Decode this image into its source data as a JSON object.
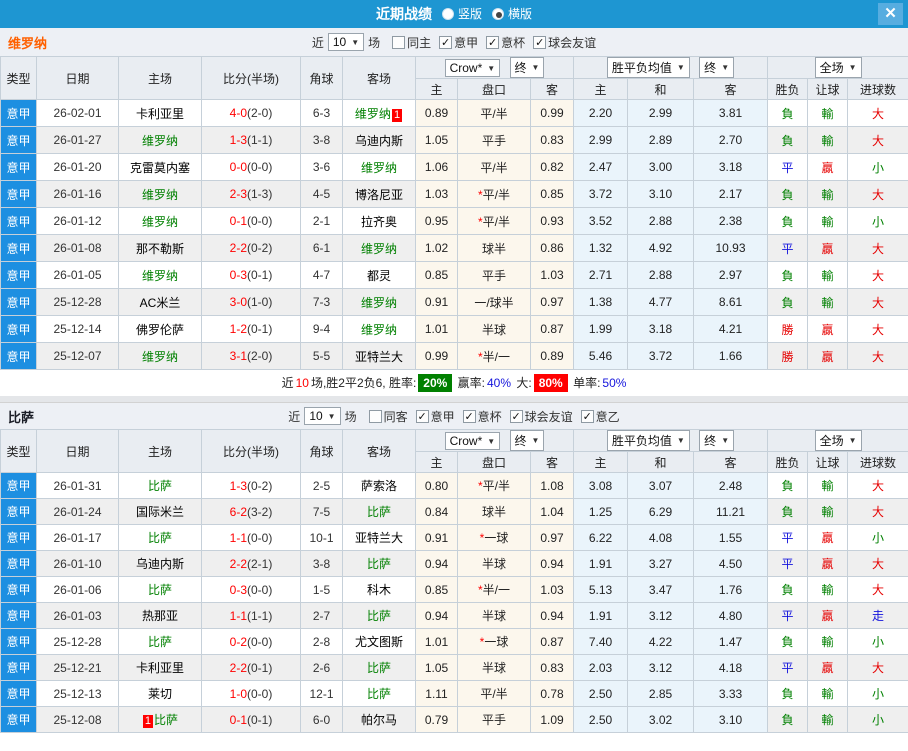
{
  "titlebar": {
    "title": "近期战绩",
    "radios": [
      {
        "label": "竖版",
        "selected": false
      },
      {
        "label": "横版",
        "selected": true
      }
    ],
    "close": "✕"
  },
  "filter_common": {
    "near": "近",
    "games_count": "10",
    "games": "场"
  },
  "header_controls": {
    "odds_select": "Crow*",
    "odds_final": "终",
    "avg_select": "胜平负均值",
    "avg_final": "终",
    "scope_select": "全场"
  },
  "columns": {
    "type": "类型",
    "date": "日期",
    "home": "主场",
    "score": "比分(半场)",
    "corner": "角球",
    "away": "客场",
    "odds_home": "主",
    "handicap": "盘口",
    "odds_away": "客",
    "avg_home": "主",
    "avg_draw": "和",
    "avg_away": "客",
    "wdl": "胜负",
    "handicap_res": "让球",
    "goals": "进球数"
  },
  "teams": [
    {
      "name": "维罗纳",
      "filters": [
        {
          "label": "同主",
          "checked": false
        },
        {
          "label": "意甲",
          "checked": true
        },
        {
          "label": "意杯",
          "checked": true
        },
        {
          "label": "球会友谊",
          "checked": true
        }
      ],
      "rows": [
        {
          "league": "意甲",
          "date": "26-02-01",
          "home": {
            "name": "卡利亚里"
          },
          "score": {
            "main": "4-0",
            "half": "(2-0)"
          },
          "corner": "6-3",
          "away": {
            "name": "维罗纳",
            "green": true,
            "badge": "1",
            "badge_pos": "after"
          },
          "o1": "0.89",
          "hcp": {
            "text": "平/半"
          },
          "o2": "0.99",
          "a1": "2.20",
          "a2": "2.99",
          "a3": "3.81",
          "wdl": {
            "t": "負",
            "c": "g"
          },
          "hres": {
            "t": "輸",
            "c": "g"
          },
          "gres": {
            "t": "大",
            "c": "r"
          }
        },
        {
          "league": "意甲",
          "date": "26-01-27",
          "home": {
            "name": "维罗纳",
            "green": true
          },
          "score": {
            "main": "1-3",
            "half": "(1-1)"
          },
          "corner": "3-8",
          "away": {
            "name": "乌迪内斯"
          },
          "o1": "1.05",
          "hcp": {
            "text": "平手"
          },
          "o2": "0.83",
          "a1": "2.99",
          "a2": "2.89",
          "a3": "2.70",
          "wdl": {
            "t": "負",
            "c": "g"
          },
          "hres": {
            "t": "輸",
            "c": "g"
          },
          "gres": {
            "t": "大",
            "c": "r"
          }
        },
        {
          "league": "意甲",
          "date": "26-01-20",
          "home": {
            "name": "克雷莫内塞"
          },
          "score": {
            "main": "0-0",
            "half": "(0-0)"
          },
          "corner": "3-6",
          "away": {
            "name": "维罗纳",
            "green": true
          },
          "o1": "1.06",
          "hcp": {
            "text": "平/半"
          },
          "o2": "0.82",
          "a1": "2.47",
          "a2": "3.00",
          "a3": "3.18",
          "wdl": {
            "t": "平",
            "c": "b"
          },
          "hres": {
            "t": "贏",
            "c": "r"
          },
          "gres": {
            "t": "小",
            "c": "g"
          }
        },
        {
          "league": "意甲",
          "date": "26-01-16",
          "home": {
            "name": "维罗纳",
            "green": true
          },
          "score": {
            "main": "2-3",
            "half": "(1-3)"
          },
          "corner": "4-5",
          "away": {
            "name": "博洛尼亚"
          },
          "o1": "1.03",
          "hcp": {
            "star": true,
            "text": "平/半"
          },
          "o2": "0.85",
          "a1": "3.72",
          "a2": "3.10",
          "a3": "2.17",
          "wdl": {
            "t": "負",
            "c": "g"
          },
          "hres": {
            "t": "輸",
            "c": "g"
          },
          "gres": {
            "t": "大",
            "c": "r"
          }
        },
        {
          "league": "意甲",
          "date": "26-01-12",
          "home": {
            "name": "维罗纳",
            "green": true
          },
          "score": {
            "main": "0-1",
            "half": "(0-0)"
          },
          "corner": "2-1",
          "away": {
            "name": "拉齐奥"
          },
          "o1": "0.95",
          "hcp": {
            "star": true,
            "text": "平/半"
          },
          "o2": "0.93",
          "a1": "3.52",
          "a2": "2.88",
          "a3": "2.38",
          "wdl": {
            "t": "負",
            "c": "g"
          },
          "hres": {
            "t": "輸",
            "c": "g"
          },
          "gres": {
            "t": "小",
            "c": "g"
          }
        },
        {
          "league": "意甲",
          "date": "26-01-08",
          "home": {
            "name": "那不勒斯"
          },
          "score": {
            "main": "2-2",
            "half": "(0-2)"
          },
          "corner": "6-1",
          "away": {
            "name": "维罗纳",
            "green": true
          },
          "o1": "1.02",
          "hcp": {
            "text": "球半"
          },
          "o2": "0.86",
          "a1": "1.32",
          "a2": "4.92",
          "a3": "10.93",
          "wdl": {
            "t": "平",
            "c": "b"
          },
          "hres": {
            "t": "贏",
            "c": "r"
          },
          "gres": {
            "t": "大",
            "c": "r"
          }
        },
        {
          "league": "意甲",
          "date": "26-01-05",
          "home": {
            "name": "维罗纳",
            "green": true
          },
          "score": {
            "main": "0-3",
            "half": "(0-1)"
          },
          "corner": "4-7",
          "away": {
            "name": "都灵"
          },
          "o1": "0.85",
          "hcp": {
            "text": "平手"
          },
          "o2": "1.03",
          "a1": "2.71",
          "a2": "2.88",
          "a3": "2.97",
          "wdl": {
            "t": "負",
            "c": "g"
          },
          "hres": {
            "t": "輸",
            "c": "g"
          },
          "gres": {
            "t": "大",
            "c": "r"
          }
        },
        {
          "league": "意甲",
          "date": "25-12-28",
          "home": {
            "name": "AC米兰"
          },
          "score": {
            "main": "3-0",
            "half": "(1-0)"
          },
          "corner": "7-3",
          "away": {
            "name": "维罗纳",
            "green": true
          },
          "o1": "0.91",
          "hcp": {
            "text": "一/球半"
          },
          "o2": "0.97",
          "a1": "1.38",
          "a2": "4.77",
          "a3": "8.61",
          "wdl": {
            "t": "負",
            "c": "g"
          },
          "hres": {
            "t": "輸",
            "c": "g"
          },
          "gres": {
            "t": "大",
            "c": "r"
          }
        },
        {
          "league": "意甲",
          "date": "25-12-14",
          "home": {
            "name": "佛罗伦萨"
          },
          "score": {
            "main": "1-2",
            "half": "(0-1)"
          },
          "corner": "9-4",
          "away": {
            "name": "维罗纳",
            "green": true
          },
          "o1": "1.01",
          "hcp": {
            "text": "半球"
          },
          "o2": "0.87",
          "a1": "1.99",
          "a2": "3.18",
          "a3": "4.21",
          "wdl": {
            "t": "勝",
            "c": "r"
          },
          "hres": {
            "t": "贏",
            "c": "r"
          },
          "gres": {
            "t": "大",
            "c": "r"
          }
        },
        {
          "league": "意甲",
          "date": "25-12-07",
          "home": {
            "name": "维罗纳",
            "green": true
          },
          "score": {
            "main": "3-1",
            "half": "(2-0)"
          },
          "corner": "5-5",
          "away": {
            "name": "亚特兰大"
          },
          "o1": "0.99",
          "hcp": {
            "star": true,
            "text": "半/一"
          },
          "o2": "0.89",
          "a1": "5.46",
          "a2": "3.72",
          "a3": "1.66",
          "wdl": {
            "t": "勝",
            "c": "r"
          },
          "hres": {
            "t": "贏",
            "c": "r"
          },
          "gres": {
            "t": "大",
            "c": "r"
          }
        }
      ],
      "summary": [
        {
          "text": "近",
          "style": "plain"
        },
        {
          "text": "10",
          "style": "red"
        },
        {
          "text": "场,胜2平2负6, 胜率:",
          "style": "plain"
        },
        {
          "text": "20%",
          "style": "badge-green"
        },
        {
          "text": " 赢率:",
          "style": "plain"
        },
        {
          "text": "40%",
          "style": "blue"
        },
        {
          "text": " 大:",
          "style": "plain"
        },
        {
          "text": "80%",
          "style": "badge-red"
        },
        {
          "text": " 单率:",
          "style": "plain"
        },
        {
          "text": "50%",
          "style": "blue"
        }
      ]
    },
    {
      "name": "比萨",
      "filters": [
        {
          "label": "同客",
          "checked": false
        },
        {
          "label": "意甲",
          "checked": true
        },
        {
          "label": "意杯",
          "checked": true
        },
        {
          "label": "球会友谊",
          "checked": true
        },
        {
          "label": "意乙",
          "checked": true
        }
      ],
      "rows": [
        {
          "league": "意甲",
          "date": "26-01-31",
          "home": {
            "name": "比萨",
            "green": true
          },
          "score": {
            "main": "1-3",
            "half": "(0-2)"
          },
          "corner": "2-5",
          "away": {
            "name": "萨索洛"
          },
          "o1": "0.80",
          "hcp": {
            "star": true,
            "text": "平/半"
          },
          "o2": "1.08",
          "a1": "3.08",
          "a2": "3.07",
          "a3": "2.48",
          "wdl": {
            "t": "負",
            "c": "g"
          },
          "hres": {
            "t": "輸",
            "c": "g"
          },
          "gres": {
            "t": "大",
            "c": "r"
          }
        },
        {
          "league": "意甲",
          "date": "26-01-24",
          "home": {
            "name": "国际米兰"
          },
          "score": {
            "main": "6-2",
            "half": "(3-2)"
          },
          "corner": "7-5",
          "away": {
            "name": "比萨",
            "green": true
          },
          "o1": "0.84",
          "hcp": {
            "text": "球半"
          },
          "o2": "1.04",
          "a1": "1.25",
          "a2": "6.29",
          "a3": "11.21",
          "wdl": {
            "t": "負",
            "c": "g"
          },
          "hres": {
            "t": "輸",
            "c": "g"
          },
          "gres": {
            "t": "大",
            "c": "r"
          }
        },
        {
          "league": "意甲",
          "date": "26-01-17",
          "home": {
            "name": "比萨",
            "green": true
          },
          "score": {
            "main": "1-1",
            "half": "(0-0)"
          },
          "corner": "10-1",
          "away": {
            "name": "亚特兰大"
          },
          "o1": "0.91",
          "hcp": {
            "star": true,
            "text": "一球"
          },
          "o2": "0.97",
          "a1": "6.22",
          "a2": "4.08",
          "a3": "1.55",
          "wdl": {
            "t": "平",
            "c": "b"
          },
          "hres": {
            "t": "贏",
            "c": "r"
          },
          "gres": {
            "t": "小",
            "c": "g"
          }
        },
        {
          "league": "意甲",
          "date": "26-01-10",
          "home": {
            "name": "乌迪内斯"
          },
          "score": {
            "main": "2-2",
            "half": "(2-1)"
          },
          "corner": "3-8",
          "away": {
            "name": "比萨",
            "green": true
          },
          "o1": "0.94",
          "hcp": {
            "text": "半球"
          },
          "o2": "0.94",
          "a1": "1.91",
          "a2": "3.27",
          "a3": "4.50",
          "wdl": {
            "t": "平",
            "c": "b"
          },
          "hres": {
            "t": "贏",
            "c": "r"
          },
          "gres": {
            "t": "大",
            "c": "r"
          }
        },
        {
          "league": "意甲",
          "date": "26-01-06",
          "home": {
            "name": "比萨",
            "green": true
          },
          "score": {
            "main": "0-3",
            "half": "(0-0)"
          },
          "corner": "1-5",
          "away": {
            "name": "科木"
          },
          "o1": "0.85",
          "hcp": {
            "star": true,
            "text": "半/一"
          },
          "o2": "1.03",
          "a1": "5.13",
          "a2": "3.47",
          "a3": "1.76",
          "wdl": {
            "t": "負",
            "c": "g"
          },
          "hres": {
            "t": "輸",
            "c": "g"
          },
          "gres": {
            "t": "大",
            "c": "r"
          }
        },
        {
          "league": "意甲",
          "date": "26-01-03",
          "home": {
            "name": "热那亚"
          },
          "score": {
            "main": "1-1",
            "half": "(1-1)"
          },
          "corner": "2-7",
          "away": {
            "name": "比萨",
            "green": true
          },
          "o1": "0.94",
          "hcp": {
            "text": "半球"
          },
          "o2": "0.94",
          "a1": "1.91",
          "a2": "3.12",
          "a3": "4.80",
          "wdl": {
            "t": "平",
            "c": "b"
          },
          "hres": {
            "t": "贏",
            "c": "r"
          },
          "gres": {
            "t": "走",
            "c": "b"
          }
        },
        {
          "league": "意甲",
          "date": "25-12-28",
          "home": {
            "name": "比萨",
            "green": true
          },
          "score": {
            "main": "0-2",
            "half": "(0-0)"
          },
          "corner": "2-8",
          "away": {
            "name": "尤文图斯"
          },
          "o1": "1.01",
          "hcp": {
            "star": true,
            "text": "一球"
          },
          "o2": "0.87",
          "a1": "7.40",
          "a2": "4.22",
          "a3": "1.47",
          "wdl": {
            "t": "負",
            "c": "g"
          },
          "hres": {
            "t": "輸",
            "c": "g"
          },
          "gres": {
            "t": "小",
            "c": "g"
          }
        },
        {
          "league": "意甲",
          "date": "25-12-21",
          "home": {
            "name": "卡利亚里"
          },
          "score": {
            "main": "2-2",
            "half": "(0-1)"
          },
          "corner": "2-6",
          "away": {
            "name": "比萨",
            "green": true
          },
          "o1": "1.05",
          "hcp": {
            "text": "半球"
          },
          "o2": "0.83",
          "a1": "2.03",
          "a2": "3.12",
          "a3": "4.18",
          "wdl": {
            "t": "平",
            "c": "b"
          },
          "hres": {
            "t": "贏",
            "c": "r"
          },
          "gres": {
            "t": "大",
            "c": "r"
          }
        },
        {
          "league": "意甲",
          "date": "25-12-13",
          "home": {
            "name": "莱切"
          },
          "score": {
            "main": "1-0",
            "half": "(0-0)"
          },
          "corner": "12-1",
          "away": {
            "name": "比萨",
            "green": true
          },
          "o1": "1.11",
          "hcp": {
            "text": "平/半"
          },
          "o2": "0.78",
          "a1": "2.50",
          "a2": "2.85",
          "a3": "3.33",
          "wdl": {
            "t": "負",
            "c": "g"
          },
          "hres": {
            "t": "輸",
            "c": "g"
          },
          "gres": {
            "t": "小",
            "c": "g"
          }
        },
        {
          "league": "意甲",
          "date": "25-12-08",
          "home": {
            "name": "比萨",
            "green": true,
            "badge": "1",
            "badge_pos": "before"
          },
          "score": {
            "main": "0-1",
            "half": "(0-1)"
          },
          "corner": "6-0",
          "away": {
            "name": "帕尔马"
          },
          "o1": "0.79",
          "hcp": {
            "text": "平手"
          },
          "o2": "1.09",
          "a1": "2.50",
          "a2": "3.02",
          "a3": "3.10",
          "wdl": {
            "t": "負",
            "c": "g"
          },
          "hres": {
            "t": "輸",
            "c": "g"
          },
          "gres": {
            "t": "小",
            "c": "g"
          }
        }
      ]
    }
  ]
}
